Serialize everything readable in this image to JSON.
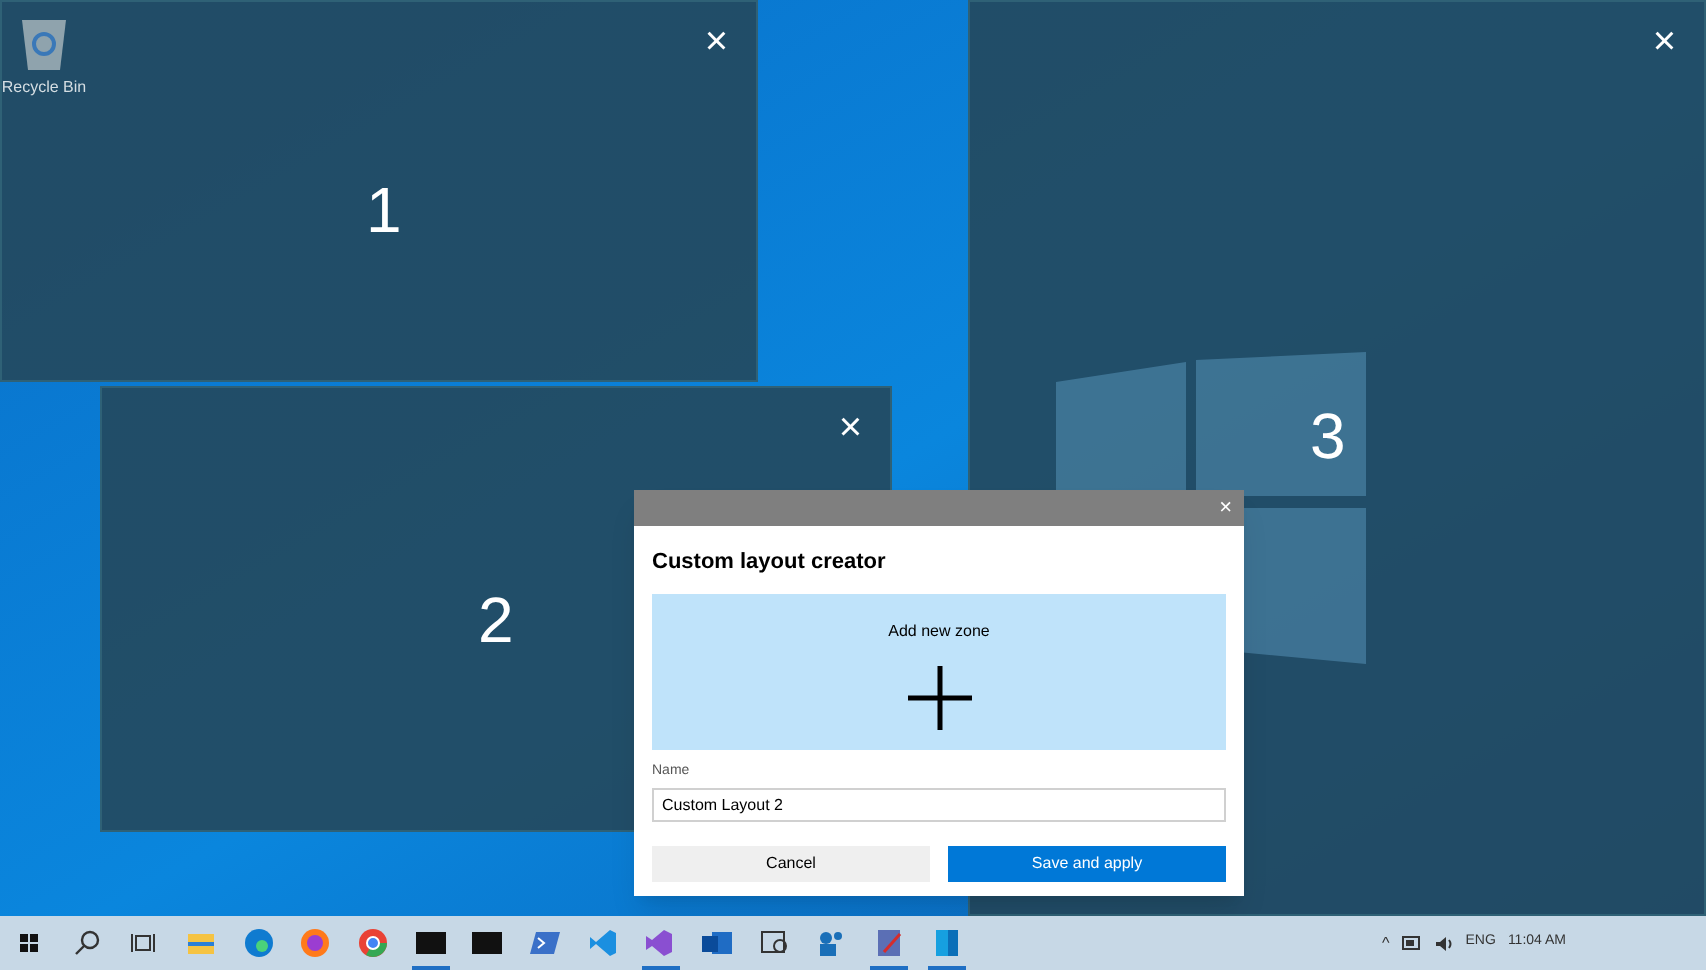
{
  "desktop": {
    "icons": [
      {
        "label": "Recycle Bin"
      }
    ]
  },
  "zones": [
    {
      "number": "1",
      "close": "×"
    },
    {
      "number": "2",
      "close": "×"
    },
    {
      "number": "3",
      "close": "×"
    }
  ],
  "dialog": {
    "close": "×",
    "title": "Custom layout creator",
    "add_zone": "Add new zone",
    "name_label": "Name",
    "name_value": "Custom Layout 2",
    "buttons": [
      {
        "label": "Cancel",
        "kind": "secondary"
      },
      {
        "label": "Save and apply",
        "kind": "primary"
      }
    ]
  },
  "taskbar": {
    "items": [
      {
        "kind": "start",
        "running": false
      },
      {
        "kind": "search",
        "running": false
      },
      {
        "kind": "taskview",
        "running": false
      },
      {
        "kind": "folder",
        "running": false
      },
      {
        "kind": "edge",
        "running": false
      },
      {
        "kind": "firefox",
        "running": false
      },
      {
        "kind": "chrome",
        "running": false
      },
      {
        "kind": "terminal",
        "running": true
      },
      {
        "kind": "terminal",
        "running": false
      },
      {
        "kind": "powershell",
        "running": false
      },
      {
        "kind": "vscode",
        "running": false
      },
      {
        "kind": "vs",
        "running": true
      },
      {
        "kind": "outlook",
        "running": false
      },
      {
        "kind": "reader",
        "running": false
      },
      {
        "kind": "teams",
        "running": false
      },
      {
        "kind": "paint",
        "running": true
      },
      {
        "kind": "app",
        "running": true
      }
    ],
    "tray": {
      "chevron": "^",
      "language": "ENG",
      "time": "11:04 AM"
    }
  }
}
